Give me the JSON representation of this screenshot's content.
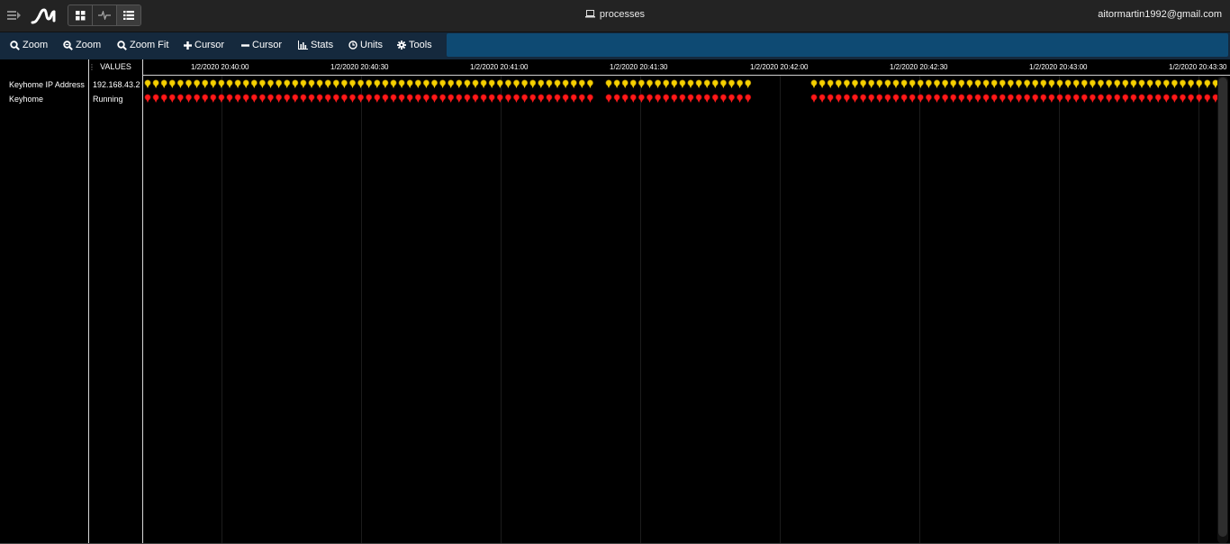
{
  "header": {
    "title": "processes",
    "user_email": "aitormartin1992@gmail.com",
    "view_modes": [
      {
        "name": "dashboard",
        "active": false
      },
      {
        "name": "pulse",
        "active": false
      },
      {
        "name": "list",
        "active": true
      }
    ]
  },
  "toolbar": {
    "zoom_in_label": "Zoom",
    "zoom_out_label": "Zoom",
    "zoom_fit_label": "Zoom Fit",
    "add_cursor_label": "Cursor",
    "remove_cursor_label": "Cursor",
    "stats_label": "Stats",
    "units_label": "Units",
    "tools_label": "Tools"
  },
  "timeline": {
    "values_header": "VALUES",
    "time_labels": [
      "1/2/2020 20:40:00",
      "1/2/2020 20:40:30",
      "1/2/2020 20:41:00",
      "1/2/2020 20:41:30",
      "1/2/2020 20:42:00",
      "1/2/2020 20:42:30",
      "1/2/2020 20:43:00",
      "1/2/2020 20:43:30"
    ],
    "signals": [
      {
        "name": "Keyhome IP Address",
        "value": "192.168.43.2",
        "marker_color": "#f5d000",
        "marker_stroke": "#8a6d00"
      },
      {
        "name": "Keyhome",
        "value": "Running",
        "marker_color": "#ff1a1a",
        "marker_stroke": "#8a0000"
      }
    ]
  },
  "colors": {
    "background": "#000000",
    "header_bg": "#232323",
    "toolbar_bg": "#15293d",
    "toolbar_field": "#0e4a73"
  }
}
